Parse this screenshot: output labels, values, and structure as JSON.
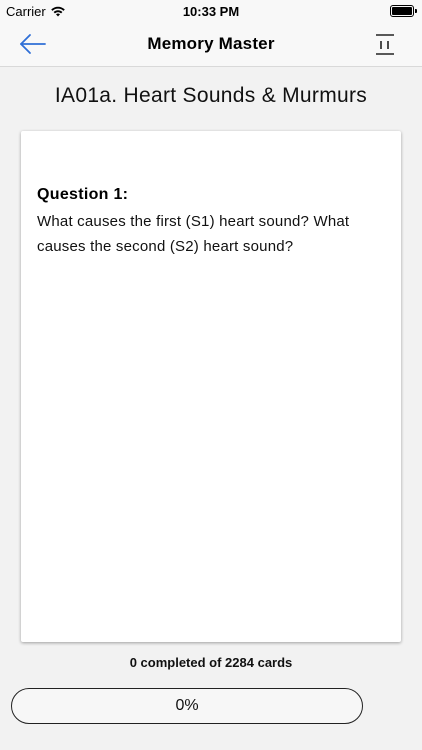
{
  "status_bar": {
    "carrier": "Carrier",
    "time": "10:33 PM",
    "icons": [
      "wifi-icon",
      "battery-icon"
    ]
  },
  "nav": {
    "title": "Memory Master",
    "back_icon": "arrow-left-icon",
    "menu_icon": "menu-icon",
    "accent_color": "#2f6fd6"
  },
  "deck": {
    "title": "IA01a. Heart Sounds & Murmurs"
  },
  "card": {
    "question_label": "Question 1:",
    "question_text": "What causes the first (S1) heart sound? What causes the second (S2) heart sound?"
  },
  "progress": {
    "caption": "0 completed of 2284 cards",
    "completed": 0,
    "total": 2284,
    "percent_label": "0%",
    "fraction": 0
  }
}
